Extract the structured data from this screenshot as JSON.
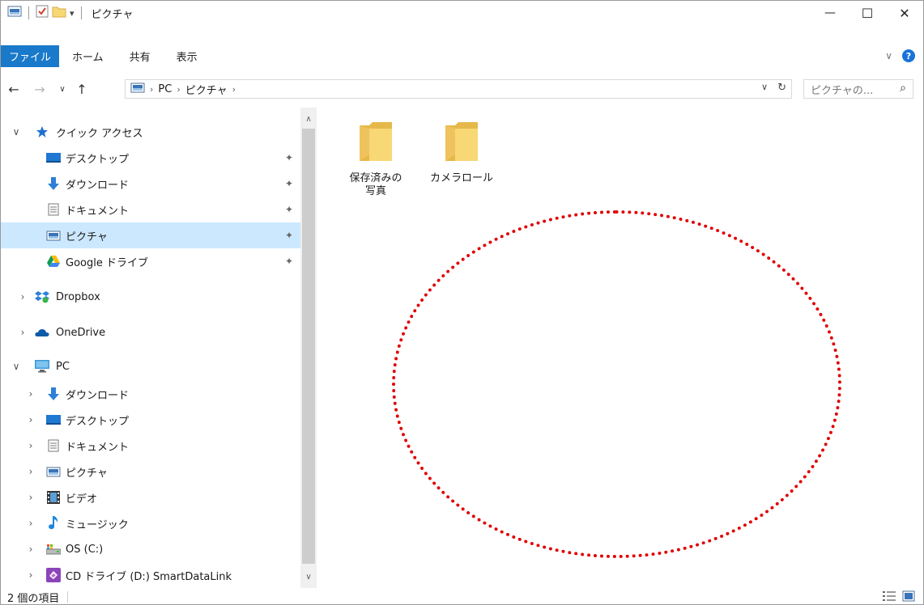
{
  "window": {
    "title": "ピクチャ",
    "minimize": "—",
    "maximize": "☐",
    "close": "✕"
  },
  "ribbon": {
    "file_tab": "ファイル",
    "tabs": [
      "ホーム",
      "共有",
      "表示"
    ],
    "help": "?"
  },
  "address": {
    "crumbs": [
      "PC",
      "ピクチャ"
    ],
    "search_placeholder": "ピクチャの..."
  },
  "sidebar": {
    "quick_access": "クイック アクセス",
    "quick_items": [
      "デスクトップ",
      "ダウンロード",
      "ドキュメント",
      "ピクチャ",
      "Google ドライブ"
    ],
    "dropbox": "Dropbox",
    "onedrive": "OneDrive",
    "pc": "PC",
    "pc_items": [
      "ダウンロード",
      "デスクトップ",
      "ドキュメント",
      "ピクチャ",
      "ビデオ",
      "ミュージック",
      "OS (C:)",
      "CD ドライブ (D:) SmartDataLink"
    ]
  },
  "content": {
    "folders": [
      {
        "label_line1": "保存済みの",
        "label_line2": "写真"
      },
      {
        "label_line1": "カメラロール",
        "label_line2": ""
      }
    ]
  },
  "status": {
    "item_count": "2 個の項目"
  },
  "colors": {
    "accent": "#1979ca",
    "selected": "#cce8ff",
    "annotation": "#e00000",
    "folder": "#f8d775"
  }
}
